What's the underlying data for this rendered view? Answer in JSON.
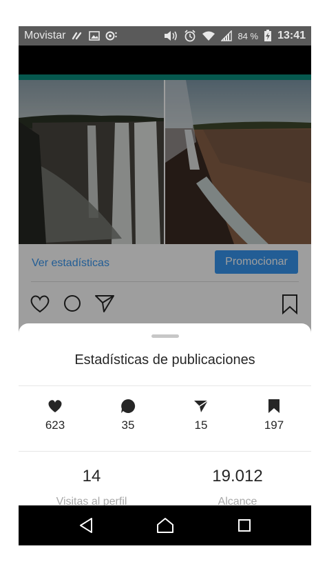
{
  "status_bar": {
    "carrier": "Movistar",
    "battery_percent": "84 %",
    "time": "13:41",
    "icons": [
      "link-icon",
      "image-icon",
      "record-icon",
      "volume-icon",
      "alarm-icon",
      "wifi-icon",
      "signal-icon",
      "battery-charging-icon"
    ]
  },
  "post": {
    "stats_link": "Ver estadísticas",
    "promote_label": "Promocionar",
    "actions": [
      "heart-icon",
      "comment-icon",
      "send-icon",
      "bookmark-icon"
    ]
  },
  "sheet": {
    "title": "Estadísticas de publicaciones",
    "stats": [
      {
        "icon": "heart-icon",
        "value": "623"
      },
      {
        "icon": "comment-icon",
        "value": "35"
      },
      {
        "icon": "send-icon",
        "value": "15"
      },
      {
        "icon": "bookmark-icon",
        "value": "197"
      }
    ],
    "metrics": [
      {
        "value": "14",
        "label": "Visitas al perfil"
      },
      {
        "value": "19.012",
        "label": "Alcance"
      }
    ]
  },
  "nav": [
    "back-icon",
    "home-icon",
    "recents-icon"
  ],
  "colors": {
    "accent": "#3897f0",
    "teal": "#0b8f7e",
    "text": "#262626",
    "muted": "#a8a8a8"
  }
}
